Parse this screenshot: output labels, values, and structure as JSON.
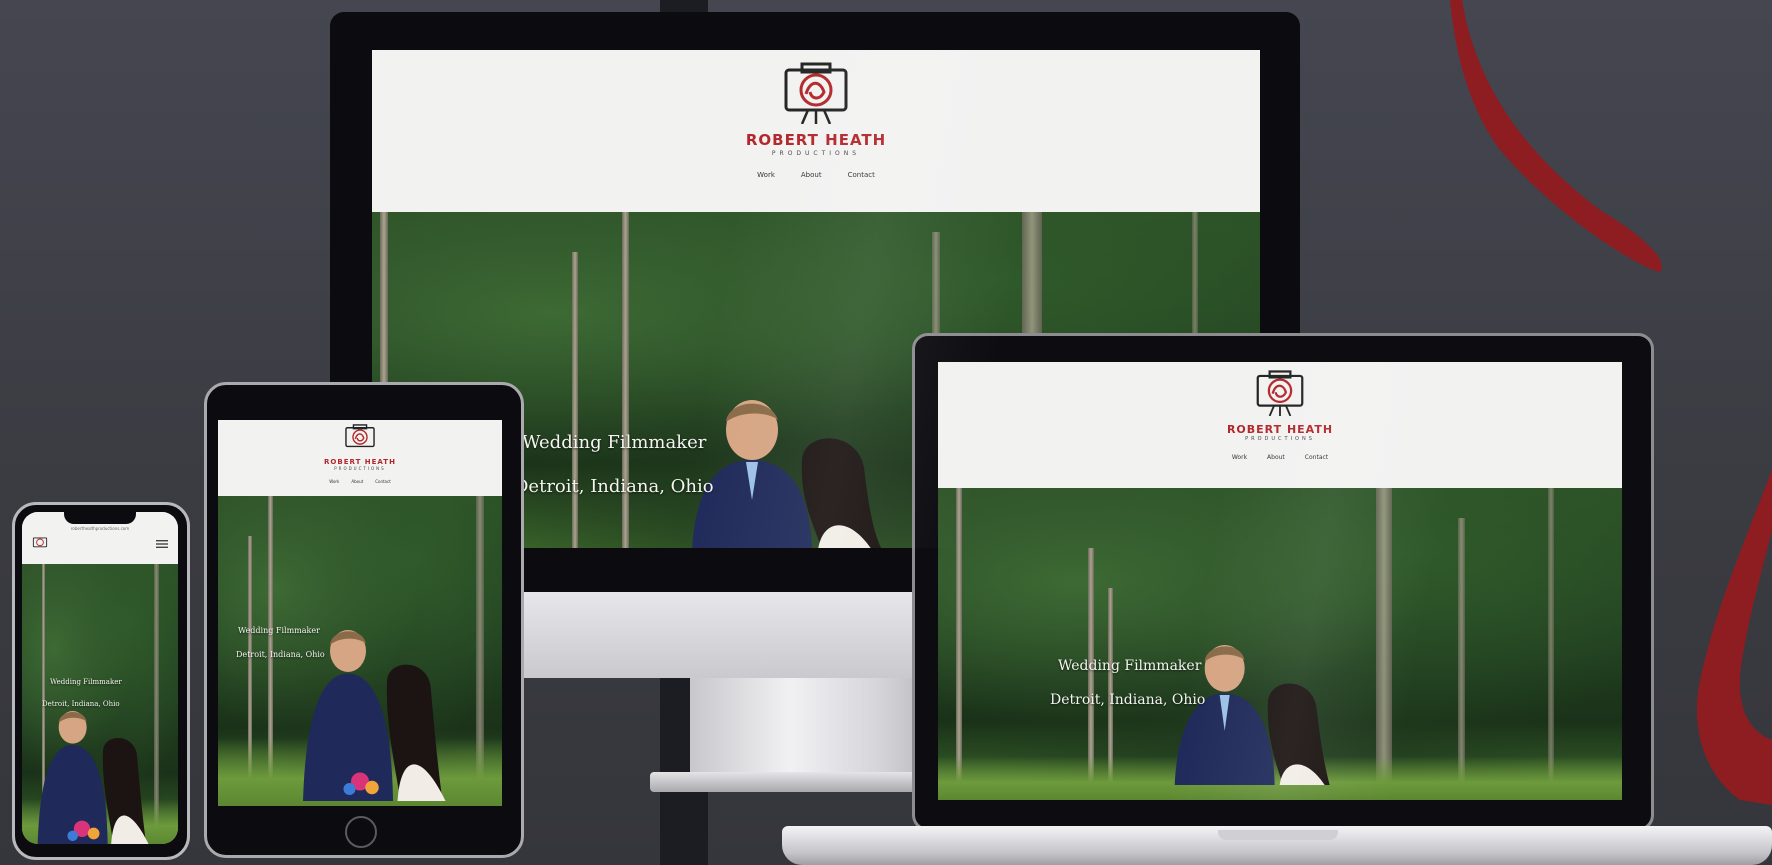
{
  "brand": {
    "name": "ROBERT HEATH",
    "tagline": "PRODUCTIONS",
    "logo_icon": "camera-monogram-icon",
    "accent_color": "#b3262b"
  },
  "nav": {
    "items": [
      {
        "label": "Work"
      },
      {
        "label": "About"
      },
      {
        "label": "Contact"
      }
    ]
  },
  "hero": {
    "headline": "Wedding Filmmaker",
    "locations": "Detroit, Indiana, Ohio"
  },
  "phone": {
    "address_bar": "roberthealthproductions.com",
    "menu_icon": "hamburger-icon"
  },
  "colors": {
    "background": "#3f4045",
    "decor_red": "#8e1d22",
    "header_bg": "#f2f2f1"
  }
}
